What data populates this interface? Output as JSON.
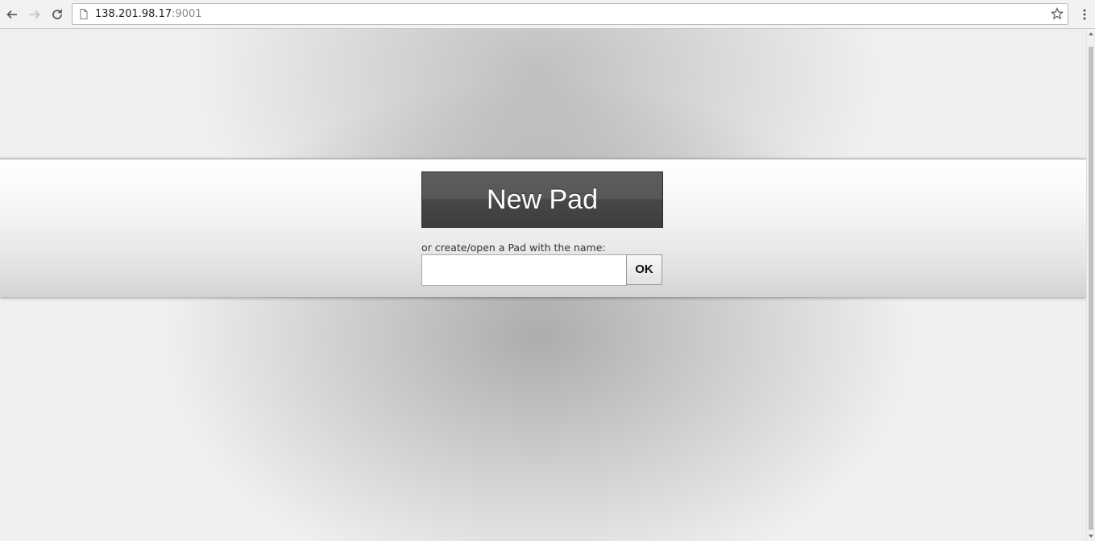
{
  "browser": {
    "url_host": "138.201.98.17",
    "url_port": ":9001",
    "icons": {
      "back": "back-arrow-icon",
      "forward": "forward-arrow-icon",
      "reload": "reload-icon",
      "page": "page-icon",
      "bookmark": "star-icon",
      "menu": "kebab-menu-icon"
    }
  },
  "pad": {
    "new_pad_label": "New Pad",
    "name_prompt": "or create/open a Pad with the name:",
    "name_value": "",
    "ok_label": "OK"
  },
  "colors": {
    "button_dark": "#474747",
    "band_top": "#ffffff",
    "band_bottom": "#d3d3d3",
    "page_background": "#efefef"
  }
}
